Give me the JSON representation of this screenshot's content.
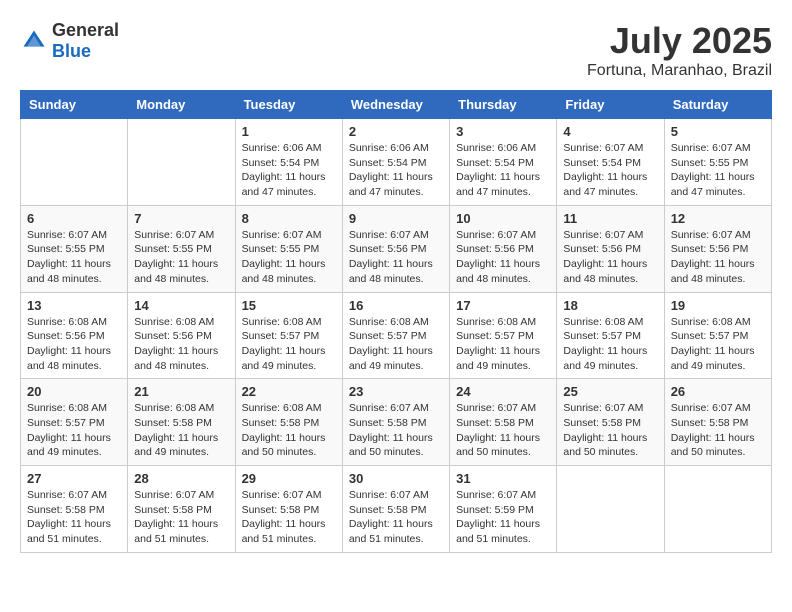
{
  "header": {
    "logo_general": "General",
    "logo_blue": "Blue",
    "month_year": "July 2025",
    "location": "Fortuna, Maranhao, Brazil"
  },
  "days_of_week": [
    "Sunday",
    "Monday",
    "Tuesday",
    "Wednesday",
    "Thursday",
    "Friday",
    "Saturday"
  ],
  "weeks": [
    [
      {
        "day": "",
        "info": ""
      },
      {
        "day": "",
        "info": ""
      },
      {
        "day": "1",
        "sunrise": "6:06 AM",
        "sunset": "5:54 PM",
        "daylight": "Daylight: 11 hours and 47 minutes."
      },
      {
        "day": "2",
        "sunrise": "6:06 AM",
        "sunset": "5:54 PM",
        "daylight": "Daylight: 11 hours and 47 minutes."
      },
      {
        "day": "3",
        "sunrise": "6:06 AM",
        "sunset": "5:54 PM",
        "daylight": "Daylight: 11 hours and 47 minutes."
      },
      {
        "day": "4",
        "sunrise": "6:07 AM",
        "sunset": "5:54 PM",
        "daylight": "Daylight: 11 hours and 47 minutes."
      },
      {
        "day": "5",
        "sunrise": "6:07 AM",
        "sunset": "5:55 PM",
        "daylight": "Daylight: 11 hours and 47 minutes."
      }
    ],
    [
      {
        "day": "6",
        "sunrise": "6:07 AM",
        "sunset": "5:55 PM",
        "daylight": "Daylight: 11 hours and 48 minutes."
      },
      {
        "day": "7",
        "sunrise": "6:07 AM",
        "sunset": "5:55 PM",
        "daylight": "Daylight: 11 hours and 48 minutes."
      },
      {
        "day": "8",
        "sunrise": "6:07 AM",
        "sunset": "5:55 PM",
        "daylight": "Daylight: 11 hours and 48 minutes."
      },
      {
        "day": "9",
        "sunrise": "6:07 AM",
        "sunset": "5:56 PM",
        "daylight": "Daylight: 11 hours and 48 minutes."
      },
      {
        "day": "10",
        "sunrise": "6:07 AM",
        "sunset": "5:56 PM",
        "daylight": "Daylight: 11 hours and 48 minutes."
      },
      {
        "day": "11",
        "sunrise": "6:07 AM",
        "sunset": "5:56 PM",
        "daylight": "Daylight: 11 hours and 48 minutes."
      },
      {
        "day": "12",
        "sunrise": "6:07 AM",
        "sunset": "5:56 PM",
        "daylight": "Daylight: 11 hours and 48 minutes."
      }
    ],
    [
      {
        "day": "13",
        "sunrise": "6:08 AM",
        "sunset": "5:56 PM",
        "daylight": "Daylight: 11 hours and 48 minutes."
      },
      {
        "day": "14",
        "sunrise": "6:08 AM",
        "sunset": "5:56 PM",
        "daylight": "Daylight: 11 hours and 48 minutes."
      },
      {
        "day": "15",
        "sunrise": "6:08 AM",
        "sunset": "5:57 PM",
        "daylight": "Daylight: 11 hours and 49 minutes."
      },
      {
        "day": "16",
        "sunrise": "6:08 AM",
        "sunset": "5:57 PM",
        "daylight": "Daylight: 11 hours and 49 minutes."
      },
      {
        "day": "17",
        "sunrise": "6:08 AM",
        "sunset": "5:57 PM",
        "daylight": "Daylight: 11 hours and 49 minutes."
      },
      {
        "day": "18",
        "sunrise": "6:08 AM",
        "sunset": "5:57 PM",
        "daylight": "Daylight: 11 hours and 49 minutes."
      },
      {
        "day": "19",
        "sunrise": "6:08 AM",
        "sunset": "5:57 PM",
        "daylight": "Daylight: 11 hours and 49 minutes."
      }
    ],
    [
      {
        "day": "20",
        "sunrise": "6:08 AM",
        "sunset": "5:57 PM",
        "daylight": "Daylight: 11 hours and 49 minutes."
      },
      {
        "day": "21",
        "sunrise": "6:08 AM",
        "sunset": "5:58 PM",
        "daylight": "Daylight: 11 hours and 49 minutes."
      },
      {
        "day": "22",
        "sunrise": "6:08 AM",
        "sunset": "5:58 PM",
        "daylight": "Daylight: 11 hours and 50 minutes."
      },
      {
        "day": "23",
        "sunrise": "6:07 AM",
        "sunset": "5:58 PM",
        "daylight": "Daylight: 11 hours and 50 minutes."
      },
      {
        "day": "24",
        "sunrise": "6:07 AM",
        "sunset": "5:58 PM",
        "daylight": "Daylight: 11 hours and 50 minutes."
      },
      {
        "day": "25",
        "sunrise": "6:07 AM",
        "sunset": "5:58 PM",
        "daylight": "Daylight: 11 hours and 50 minutes."
      },
      {
        "day": "26",
        "sunrise": "6:07 AM",
        "sunset": "5:58 PM",
        "daylight": "Daylight: 11 hours and 50 minutes."
      }
    ],
    [
      {
        "day": "27",
        "sunrise": "6:07 AM",
        "sunset": "5:58 PM",
        "daylight": "Daylight: 11 hours and 51 minutes."
      },
      {
        "day": "28",
        "sunrise": "6:07 AM",
        "sunset": "5:58 PM",
        "daylight": "Daylight: 11 hours and 51 minutes."
      },
      {
        "day": "29",
        "sunrise": "6:07 AM",
        "sunset": "5:58 PM",
        "daylight": "Daylight: 11 hours and 51 minutes."
      },
      {
        "day": "30",
        "sunrise": "6:07 AM",
        "sunset": "5:58 PM",
        "daylight": "Daylight: 11 hours and 51 minutes."
      },
      {
        "day": "31",
        "sunrise": "6:07 AM",
        "sunset": "5:59 PM",
        "daylight": "Daylight: 11 hours and 51 minutes."
      },
      {
        "day": "",
        "info": ""
      },
      {
        "day": "",
        "info": ""
      }
    ]
  ]
}
